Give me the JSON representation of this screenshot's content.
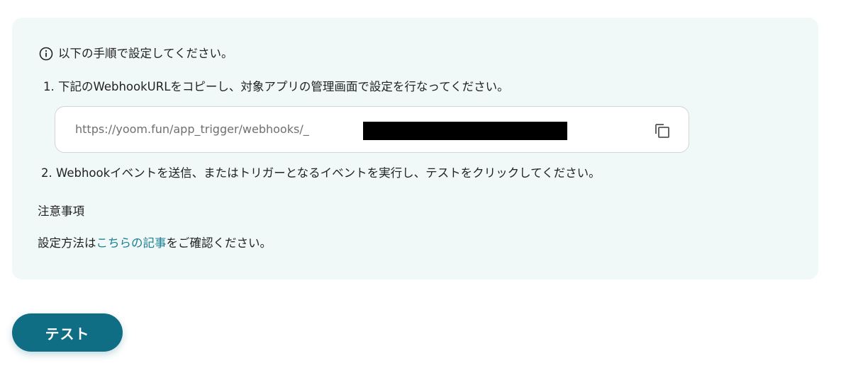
{
  "instructions": {
    "intro": "以下の手順で設定してください。",
    "step1": "1. 下記のWebhookURLをコピーし、対象アプリの管理画面で設定を行なってください。",
    "step2": "2. Webhookイベントを送信、またはトリガーとなるイベントを実行し、テストをクリックしてください。"
  },
  "webhook": {
    "url_prefix": "https://yoom.fun/app_trigger/webhooks/_",
    "copy_icon": "copy-icon"
  },
  "notes": {
    "heading": "注意事項",
    "body_prefix": "設定方法は",
    "link_text": "こちらの記事",
    "body_suffix": "をご確認ください。"
  },
  "actions": {
    "test_label": "テスト"
  },
  "colors": {
    "panel_background": "#f1f8f8",
    "accent": "#0f6d84",
    "link": "#1b7f93"
  }
}
